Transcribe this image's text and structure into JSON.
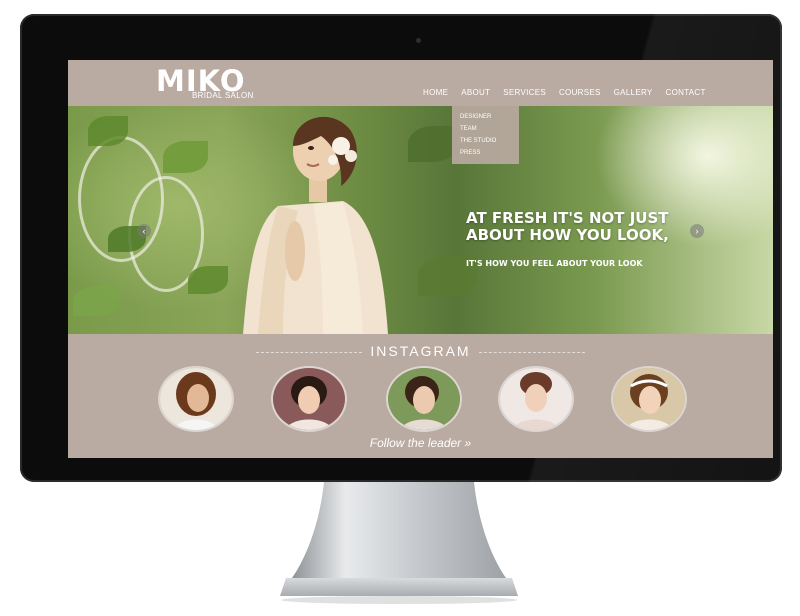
{
  "brand": {
    "logo": "MIKO",
    "tagline": "BRIDAL SALON"
  },
  "nav": {
    "items": [
      {
        "label": "HOME"
      },
      {
        "label": "ABOUT"
      },
      {
        "label": "SERVICES"
      },
      {
        "label": "COURSES"
      },
      {
        "label": "GALLERY"
      },
      {
        "label": "CONTACT"
      }
    ],
    "about_dropdown": [
      {
        "label": "DESIGNER"
      },
      {
        "label": "TEAM"
      },
      {
        "label": "THE STUDIO"
      },
      {
        "label": "PRESS"
      }
    ]
  },
  "hero": {
    "headline_line1": "AT FRESH IT'S NOT JUST",
    "headline_line2": "ABOUT HOW YOU LOOK,",
    "subheadline": "IT'S HOW YOU FEEL ABOUT YOUR LOOK",
    "prev_icon": "chevron-left-icon",
    "next_icon": "chevron-right-icon"
  },
  "instagram": {
    "title": "INSTAGRAM",
    "follow_link": "Follow the leader »"
  },
  "colors": {
    "page_bg": "#b9aaa2",
    "text": "#ffffff",
    "bezel": "#0c0c0c"
  }
}
